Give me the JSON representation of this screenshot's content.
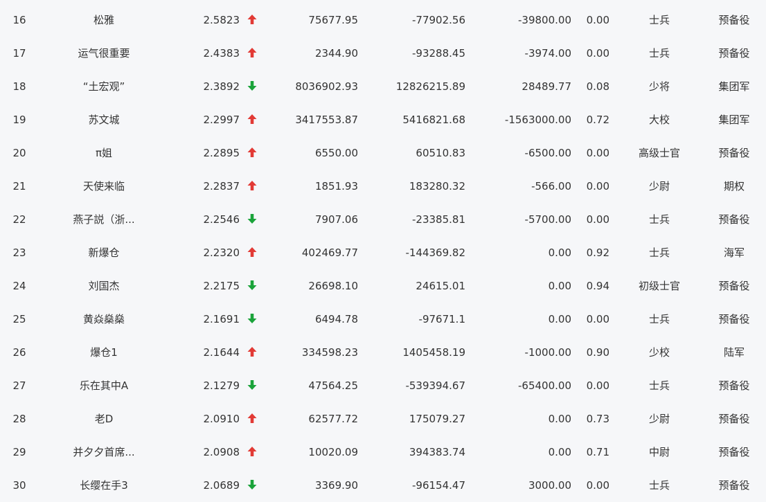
{
  "colors": {
    "background": "#f6f7f9",
    "text": "#333333",
    "up": "#e23a35",
    "down": "#1aa33a"
  },
  "rows": [
    {
      "rank": "16",
      "name": "松雅",
      "score": "2.5823",
      "trend": "up",
      "trend_icon": "up-arrow-icon",
      "v1": "75677.95",
      "v2": "-77902.56",
      "v3": "-39800.00",
      "v4": "0.00",
      "title": "士兵",
      "group": "预备役"
    },
    {
      "rank": "17",
      "name": "运气很重要",
      "score": "2.4383",
      "trend": "up",
      "trend_icon": "up-arrow-icon",
      "v1": "2344.90",
      "v2": "-93288.45",
      "v3": "-3974.00",
      "v4": "0.00",
      "title": "士兵",
      "group": "预备役"
    },
    {
      "rank": "18",
      "name": "“土宏观”",
      "score": "2.3892",
      "trend": "down",
      "trend_icon": "down-arrow-icon",
      "v1": "8036902.93",
      "v2": "12826215.89",
      "v3": "28489.77",
      "v4": "0.08",
      "title": "少将",
      "group": "集团军"
    },
    {
      "rank": "19",
      "name": "苏文城",
      "score": "2.2997",
      "trend": "up",
      "trend_icon": "up-arrow-icon",
      "v1": "3417553.87",
      "v2": "5416821.68",
      "v3": "-1563000.00",
      "v4": "0.72",
      "title": "大校",
      "group": "集团军"
    },
    {
      "rank": "20",
      "name": "π姐",
      "score": "2.2895",
      "trend": "up",
      "trend_icon": "up-arrow-icon",
      "v1": "6550.00",
      "v2": "60510.83",
      "v3": "-6500.00",
      "v4": "0.00",
      "title": "高级士官",
      "group": "预备役"
    },
    {
      "rank": "21",
      "name": "天使来临",
      "score": "2.2837",
      "trend": "up",
      "trend_icon": "up-arrow-icon",
      "v1": "1851.93",
      "v2": "183280.32",
      "v3": "-566.00",
      "v4": "0.00",
      "title": "少尉",
      "group": "期权"
    },
    {
      "rank": "22",
      "name": "燕子説（浙...",
      "score": "2.2546",
      "trend": "down",
      "trend_icon": "down-arrow-icon",
      "v1": "7907.06",
      "v2": "-23385.81",
      "v3": "-5700.00",
      "v4": "0.00",
      "title": "士兵",
      "group": "预备役"
    },
    {
      "rank": "23",
      "name": "新爆仓",
      "score": "2.2320",
      "trend": "up",
      "trend_icon": "up-arrow-icon",
      "v1": "402469.77",
      "v2": "-144369.82",
      "v3": "0.00",
      "v4": "0.92",
      "title": "士兵",
      "group": "海军"
    },
    {
      "rank": "24",
      "name": "刘国杰",
      "score": "2.2175",
      "trend": "down",
      "trend_icon": "down-arrow-icon",
      "v1": "26698.10",
      "v2": "24615.01",
      "v3": "0.00",
      "v4": "0.94",
      "title": "初级士官",
      "group": "预备役"
    },
    {
      "rank": "25",
      "name": "黄焱燊燊",
      "score": "2.1691",
      "trend": "down",
      "trend_icon": "down-arrow-icon",
      "v1": "6494.78",
      "v2": "-97671.1",
      "v3": "0.00",
      "v4": "0.00",
      "title": "士兵",
      "group": "预备役"
    },
    {
      "rank": "26",
      "name": "爆仓1",
      "score": "2.1644",
      "trend": "up",
      "trend_icon": "up-arrow-icon",
      "v1": "334598.23",
      "v2": "1405458.19",
      "v3": "-1000.00",
      "v4": "0.90",
      "title": "少校",
      "group": "陆军"
    },
    {
      "rank": "27",
      "name": "乐在其中A",
      "score": "2.1279",
      "trend": "down",
      "trend_icon": "down-arrow-icon",
      "v1": "47564.25",
      "v2": "-539394.67",
      "v3": "-65400.00",
      "v4": "0.00",
      "title": "士兵",
      "group": "预备役"
    },
    {
      "rank": "28",
      "name": "老D",
      "score": "2.0910",
      "trend": "up",
      "trend_icon": "up-arrow-icon",
      "v1": "62577.72",
      "v2": "175079.27",
      "v3": "0.00",
      "v4": "0.73",
      "title": "少尉",
      "group": "预备役"
    },
    {
      "rank": "29",
      "name": "并夕夕首席...",
      "score": "2.0908",
      "trend": "up",
      "trend_icon": "up-arrow-icon",
      "v1": "10020.09",
      "v2": "394383.74",
      "v3": "0.00",
      "v4": "0.71",
      "title": "中尉",
      "group": "预备役"
    },
    {
      "rank": "30",
      "name": "长缨在手3",
      "score": "2.0689",
      "trend": "down",
      "trend_icon": "down-arrow-icon",
      "v1": "3369.90",
      "v2": "-96154.47",
      "v3": "3000.00",
      "v4": "0.00",
      "title": "士兵",
      "group": "预备役"
    }
  ]
}
